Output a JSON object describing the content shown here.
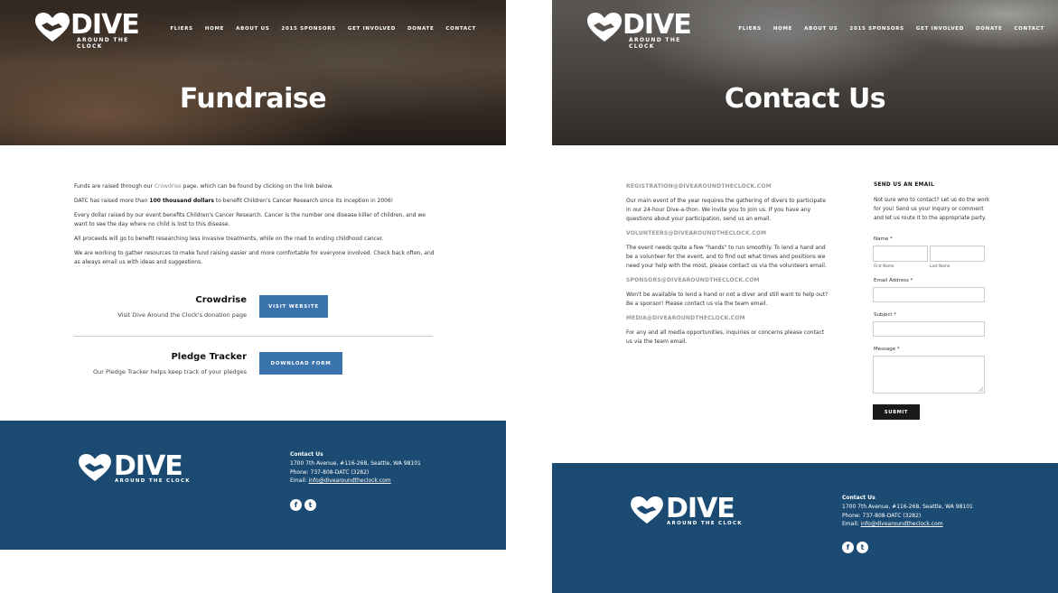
{
  "brand": {
    "word": "DIVE",
    "tagline": "AROUND THE CLOCK"
  },
  "nav": [
    "FLIERS",
    "HOME",
    "ABOUT US",
    "2015 SPONSORS",
    "GET INVOLVED",
    "DONATE",
    "CONTACT"
  ],
  "fundraise": {
    "title": "Fundraise",
    "paragraphs": {
      "p1_before": "Funds are raised through our ",
      "p1_link": "Crowdrise",
      "p1_after": " page, which can be found by clicking on the link below.",
      "p2_before": "DATC has raised more than ",
      "p2_bold": "100 thousand dollars",
      "p2_after": " to benefit Children's Cancer Research since its inception in 2006!",
      "p3": "Every dollar raised by our event benefits Children's Cancer Research. Cancer is the number one disease killer of children, and we want to see the day where no child is lost to this disease.",
      "p4": "All proceeds will go to benefit researching less invasive treatments, while on the road to ending childhood cancer.",
      "p5": "We are working to gather resources to make fund raising easier and more comfortable for everyone involved. Check back often, and as always email us with ideas and suggestions."
    },
    "crowdrise": {
      "label": "Crowdrise",
      "desc": "Visit Dive Around the Clock's donation page",
      "button": "VISIT WEBSITE"
    },
    "pledge": {
      "label": "Pledge Tracker",
      "desc": "Our Pledge Tracker helps keep track of your pledges",
      "button": "DOWNLOAD FORM"
    }
  },
  "contact": {
    "title": "Contact Us",
    "blocks": [
      {
        "email": "REGISTRATION@DIVEAROUNDTHECLOCK.COM",
        "text": "Our main event of the year requires the gathering of divers to participate in our 24-hour Dive-a-thon. We invite you to join us. If you have any questions about your participation, send us an email."
      },
      {
        "email": "VOLUNTEERS@DIVEAROUNDTHECLOCK.COM",
        "text": "The event needs quite a few \"hands\" to run smoothly. To lend a hand and be a volunteer for the event, and to find out what times and positions we need your help with the most, please contact us via the volunteers email."
      },
      {
        "email": "SPONSORS@DIVEAROUNDTHECLOCK.COM",
        "text": "Won't be available to lend a hand or not a diver and still want to help out? Be a sponsor! Please contact us via the team email."
      },
      {
        "email": "MEDIA@DIVEAROUNDTHECLOCK.COM",
        "text": "For any and all media opportunities, inquiries or concerns please contact us via the team email."
      }
    ],
    "form": {
      "title": "SEND US AN EMAIL",
      "intro": "Not sure who to contact? Let us do the work for you! Send us your inquiry or comment and let us route it to the appropriate party.",
      "name_label": "Name *",
      "first_name": "First Name",
      "last_name": "Last Name",
      "email_label": "Email Address *",
      "subject_label": "Subject *",
      "message_label": "Message *",
      "submit": "SUBMIT"
    }
  },
  "footer": {
    "heading": "Contact Us",
    "address": "1700 7th Avenue, #116-268, Seattle, WA 98101",
    "phone": "Phone: 737-808-DATC (3282)",
    "email_prefix": "Email: ",
    "email": "info@divearoundtheclock.com"
  },
  "colors": {
    "footer_bg": "#1b4b72",
    "button_blue": "#3b73ad",
    "submit_bg": "#1a1a1a"
  },
  "icons": [
    "heart-diver-logo-icon",
    "facebook-icon",
    "twitter-icon",
    "resize-handle-icon"
  ]
}
